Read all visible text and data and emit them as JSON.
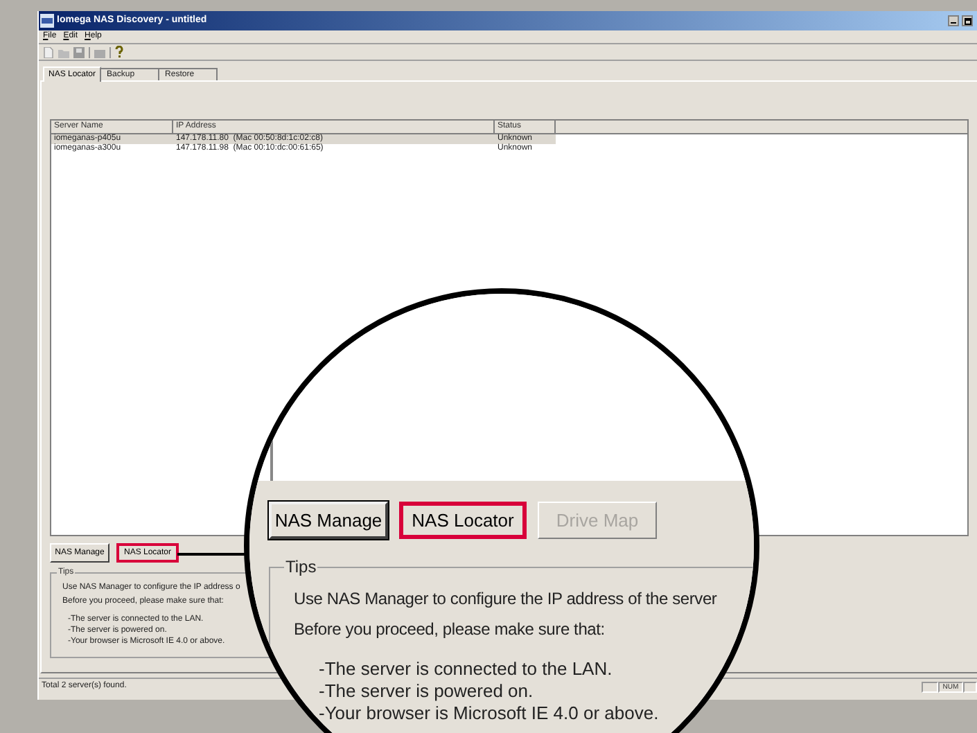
{
  "window": {
    "title": "Iomega NAS Discovery - untitled"
  },
  "menu": [
    "File",
    "Edit",
    "Help"
  ],
  "tabs": [
    {
      "label": "NAS Locator",
      "selected": true
    },
    {
      "label": "Backup",
      "selected": false
    },
    {
      "label": "Restore",
      "selected": false
    }
  ],
  "table": {
    "columns": [
      "Server Name",
      "IP Address",
      "Status"
    ],
    "rows": [
      {
        "cells": [
          "iomeganas-p405u",
          "147.178.11.80  (Mac 00:50:8d:1c:02:c8)",
          "Unknown"
        ],
        "selected": true
      },
      {
        "cells": [
          "iomeganas-a300u",
          "147.178.11.98  (Mac 00:10:dc:00:61:65)",
          "Unknown"
        ],
        "selected": false
      }
    ]
  },
  "buttons": [
    {
      "label": "NAS Manage",
      "highlighted": false
    },
    {
      "label": "NAS Locator",
      "highlighted": true
    }
  ],
  "tips": {
    "title": "Tips",
    "intro": [
      "Use NAS Manager to configure the IP address o",
      "Before you proceed, please make sure that:"
    ],
    "checks": [
      "-The server is connected to the LAN.",
      "-The server is powered on.",
      "-Your browser is Microsoft IE 4.0 or above."
    ]
  },
  "status_bar": {
    "text": "Total 2 server(s) found.",
    "indicator": "NUM"
  },
  "magnifier": {
    "buttons": [
      {
        "label": "NAS Manage",
        "highlighted": false,
        "disabled": false
      },
      {
        "label": "NAS Locator",
        "highlighted": true,
        "disabled": false
      },
      {
        "label": "Drive Map",
        "highlighted": false,
        "disabled": true
      }
    ],
    "tips_title": "Tips",
    "intro": [
      "Use NAS Manager to configure the IP address of the server",
      "Before you proceed, please make sure that:"
    ],
    "checks": [
      "-The server is connected to the LAN.",
      "-The server is powered on.",
      "-Your browser is Microsoft IE 4.0 or above."
    ]
  }
}
